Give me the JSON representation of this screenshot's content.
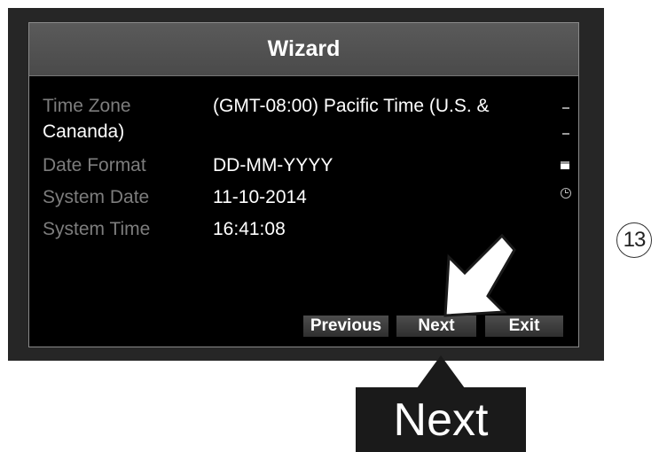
{
  "dialog": {
    "title": "Wizard",
    "fields": [
      {
        "label": "Time Zone",
        "value": "(GMT-08:00) Pacific Time (U.S. &",
        "value_cont": "Cananda)"
      },
      {
        "label": "Date Format",
        "value": "DD-MM-YYYY"
      },
      {
        "label": "System Date",
        "value": "11-10-2014"
      },
      {
        "label": "System Time",
        "value": "16:41:08"
      }
    ],
    "buttons": {
      "previous": "Previous",
      "next": "Next",
      "exit": "Exit"
    },
    "side_icons": [
      "dash-icon",
      "dash-icon",
      "bar-icon",
      "clock-icon"
    ]
  },
  "callout": {
    "label": "Next"
  },
  "step_badge": "13",
  "colors": {
    "label": "#7d7d7d",
    "value": "#ffffff",
    "titlebar": "#505050",
    "frame": "#262626"
  }
}
